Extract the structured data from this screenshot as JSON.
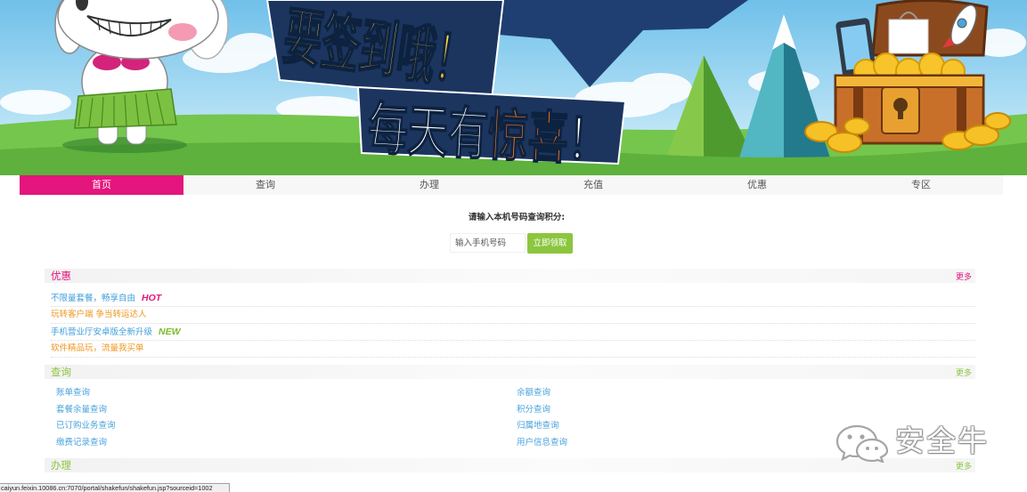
{
  "banner": {
    "headline": "要签到哦！",
    "subline_lead": "每天有",
    "subline_highlight": "惊喜",
    "subline_tail": "！"
  },
  "nav": {
    "tabs": [
      {
        "label": "首页",
        "active": true
      },
      {
        "label": "查询",
        "active": false
      },
      {
        "label": "办理",
        "active": false
      },
      {
        "label": "充值",
        "active": false
      },
      {
        "label": "优惠",
        "active": false
      },
      {
        "label": "专区",
        "active": false
      }
    ]
  },
  "points_query": {
    "prompt": "请输入本机号码查询积分:",
    "phone_placeholder": "输入手机号码",
    "submit_label": "立即领取"
  },
  "sections": {
    "offers": {
      "title": "优惠",
      "more": "更多",
      "color": "#e4157c",
      "items": [
        {
          "text": "不限量套餐，畅享自由",
          "badge": "HOT",
          "color": "#3f9fdb",
          "badge_color": "#e4157c"
        },
        {
          "text": "玩转客户端 争当转运达人",
          "color": "#f0961e"
        },
        {
          "text": "手机营业厅安卓版全新升级",
          "badge": "NEW",
          "color": "#3f9fdb",
          "badge_color": "#7dbb2c"
        },
        {
          "text": "软件精品玩，流量我买单",
          "color": "#f0961e"
        }
      ]
    },
    "query": {
      "title": "查询",
      "more": "更多",
      "color": "#8cc63f",
      "link_color": "#4aa3dd",
      "rows": [
        [
          "账单查询",
          "余额查询"
        ],
        [
          "套餐余量查询",
          "积分查询"
        ],
        [
          "已订购业务查询",
          "归属地查询"
        ],
        [
          "缴费记录查询",
          "用户信息查询"
        ]
      ]
    },
    "handle": {
      "title": "办理",
      "more": "更多",
      "color": "#8cc63f"
    }
  },
  "status_bar": {
    "url": "caiyun.feixin.10086.cn:7070/portal/shakefun/shakefun.jsp?sourceid=1002"
  },
  "watermark": {
    "icon": "wechat-icon",
    "text": "安全牛"
  },
  "colors": {
    "accent_pink": "#e4157c",
    "accent_green": "#8cc63f",
    "nav_text": "#555555",
    "banner_orange": "#ff7b1c"
  }
}
